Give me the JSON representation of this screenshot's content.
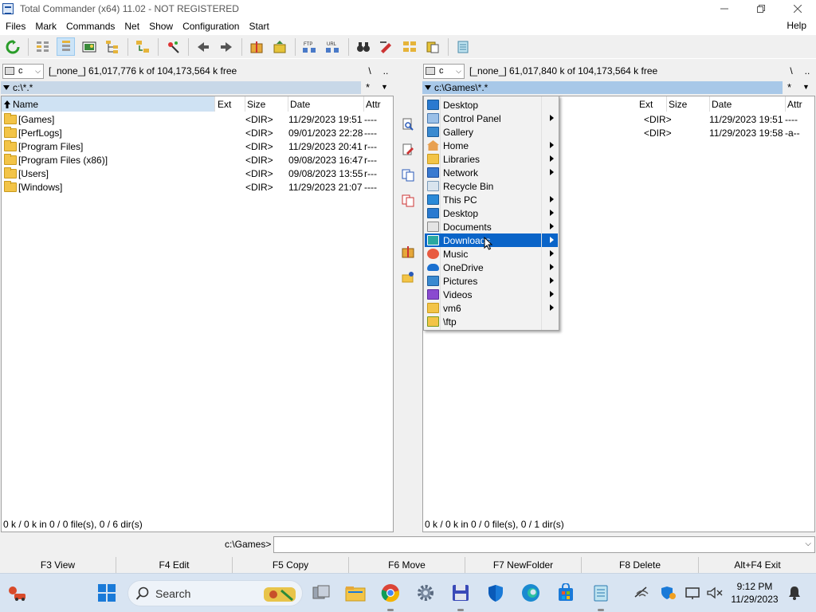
{
  "window": {
    "title": "Total Commander (x64) 11.02 - NOT REGISTERED",
    "controls": [
      "minimize",
      "maximize",
      "close"
    ]
  },
  "menu": {
    "items": [
      "Files",
      "Mark",
      "Commands",
      "Net",
      "Show",
      "Configuration",
      "Start"
    ],
    "help": "Help"
  },
  "left_panel": {
    "drive": "c",
    "free": "[_none_]  61,017,776 k of 104,173,564 k free",
    "path": "c:\\*.*",
    "nav_root": "\\",
    "nav_up": "..",
    "filter_star": "*",
    "columns": {
      "name": "Name",
      "ext": "Ext",
      "size": "Size",
      "date": "Date",
      "attr": "Attr"
    },
    "rows": [
      {
        "name": "[Games]",
        "size": "<DIR>",
        "date": "11/29/2023 19:51",
        "attr": "----"
      },
      {
        "name": "[PerfLogs]",
        "size": "<DIR>",
        "date": "09/01/2023 22:28",
        "attr": "----"
      },
      {
        "name": "[Program Files]",
        "size": "<DIR>",
        "date": "11/29/2023 20:41",
        "attr": "r---"
      },
      {
        "name": "[Program Files (x86)]",
        "size": "<DIR>",
        "date": "09/08/2023 16:47",
        "attr": "r---"
      },
      {
        "name": "[Users]",
        "size": "<DIR>",
        "date": "09/08/2023 13:55",
        "attr": "r---"
      },
      {
        "name": "[Windows]",
        "size": "<DIR>",
        "date": "11/29/2023 21:07",
        "attr": "----"
      }
    ],
    "status": "0 k / 0 k in 0 / 0 file(s), 0 / 6 dir(s)"
  },
  "right_panel": {
    "drive": "c",
    "free": "[_none_]  61,017,840 k of 104,173,564 k free",
    "path": "c:\\Games\\*.*",
    "nav_root": "\\",
    "nav_up": "..",
    "filter_star": "*",
    "columns": {
      "ext": "Ext",
      "size": "Size",
      "date": "Date",
      "attr": "Attr"
    },
    "rows": [
      {
        "size": "<DIR>",
        "date": "11/29/2023 19:51",
        "attr": "----"
      },
      {
        "size": "<DIR>",
        "date": "11/29/2023 19:58",
        "attr": "-a--"
      }
    ],
    "status": "0 k / 0 k in 0 / 0 file(s), 0 / 1 dir(s)"
  },
  "dropdown_menu": {
    "items": [
      {
        "label": "Desktop",
        "icon": "desktop-icon",
        "submenu": false
      },
      {
        "label": "Control Panel",
        "icon": "control-panel-icon",
        "submenu": true
      },
      {
        "label": "Gallery",
        "icon": "gallery-icon",
        "submenu": false
      },
      {
        "label": "Home",
        "icon": "home-icon",
        "submenu": true
      },
      {
        "label": "Libraries",
        "icon": "libraries-icon",
        "submenu": true
      },
      {
        "label": "Network",
        "icon": "network-icon",
        "submenu": true
      },
      {
        "label": "Recycle Bin",
        "icon": "recycle-bin-icon",
        "submenu": false
      },
      {
        "label": "This PC",
        "icon": "this-pc-icon",
        "submenu": true
      },
      {
        "label": "Desktop",
        "icon": "desktop-icon",
        "submenu": true
      },
      {
        "label": "Documents",
        "icon": "documents-icon",
        "submenu": true
      },
      {
        "label": "Downloads",
        "icon": "downloads-icon",
        "submenu": true,
        "highlighted": true
      },
      {
        "label": "Music",
        "icon": "music-icon",
        "submenu": true
      },
      {
        "label": "OneDrive",
        "icon": "onedrive-icon",
        "submenu": true
      },
      {
        "label": "Pictures",
        "icon": "pictures-icon",
        "submenu": true
      },
      {
        "label": "Videos",
        "icon": "videos-icon",
        "submenu": true
      },
      {
        "label": "vm6",
        "icon": "folder-icon",
        "submenu": true
      },
      {
        "label": "\\ftp",
        "icon": "ftp-folder-icon",
        "submenu": false
      }
    ]
  },
  "command_line": {
    "label": "c:\\Games>",
    "value": ""
  },
  "function_keys": [
    "F3 View",
    "F4 Edit",
    "F5 Copy",
    "F6 Move",
    "F7 NewFolder",
    "F8 Delete",
    "Alt+F4 Exit"
  ],
  "taskbar": {
    "search_label": "Search",
    "time": "9:12 PM",
    "date": "11/29/2023"
  },
  "colors": {
    "highlight": "#0a64c8",
    "path_active": "#a8c8e8",
    "sorted_header": "#cfe2f3",
    "folder": "#f3c447"
  }
}
